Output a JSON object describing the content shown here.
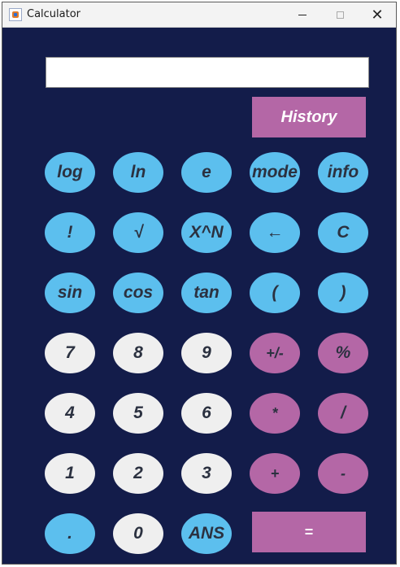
{
  "window": {
    "title": "Calculator",
    "minimize": "—",
    "maximize": "☐",
    "close": "✕"
  },
  "display": {
    "value": ""
  },
  "history_label": "History",
  "equals_label": "=",
  "keys": {
    "log": "log",
    "ln": "ln",
    "e": "e",
    "mode": "mode",
    "info": "info",
    "factorial": "!",
    "sqrt": "√",
    "power": "X^N",
    "backspace": "←",
    "clear": "C",
    "sin": "sin",
    "cos": "cos",
    "tan": "tan",
    "lparen": "(",
    "rparen": ")",
    "seven": "7",
    "eight": "8",
    "nine": "9",
    "negate": "+/-",
    "percent": "%",
    "four": "4",
    "five": "5",
    "six": "6",
    "multiply": "*",
    "divide": "/",
    "one": "1",
    "two": "2",
    "three": "3",
    "plus": "+",
    "minus": "-",
    "dot": ".",
    "zero": "0",
    "ans": "ANS"
  },
  "colors": {
    "background": "#131c4a",
    "blue_key": "#5cbfee",
    "white_key": "#efefef",
    "pink_key": "#b467a6"
  }
}
